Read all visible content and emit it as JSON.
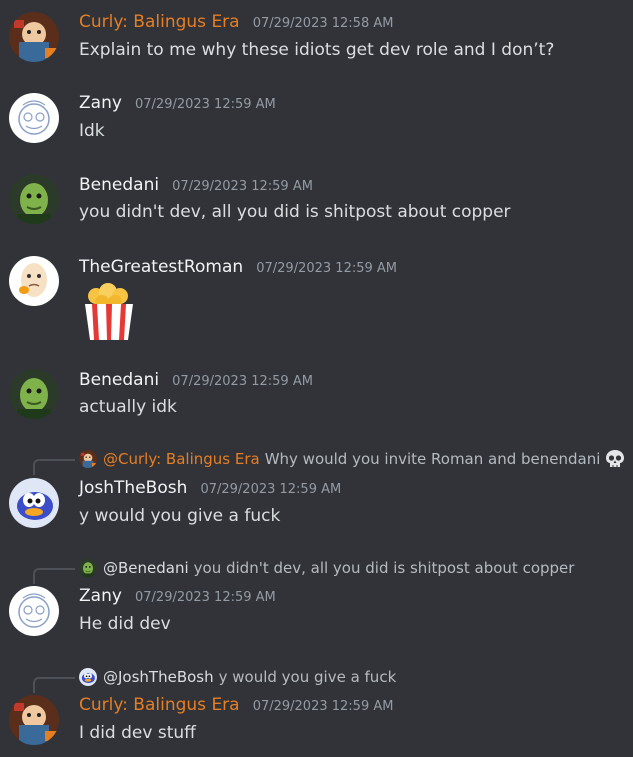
{
  "colors": {
    "background": "#313338",
    "text": "#dbdee1",
    "timestamp": "#949ba4",
    "author_default": "#f2f3f5",
    "author_orange": "#e67e22"
  },
  "messages": [
    {
      "author": "Curly: Balingus Era",
      "author_color": "#e67e22",
      "timestamp": "07/29/2023 12:58 AM",
      "content": "Explain to me why these idiots get dev role and I don’t?",
      "avatar_icon": "cartoon-character-avatar"
    },
    {
      "author": "Zany",
      "author_color": "#f2f3f5",
      "timestamp": "07/29/2023 12:59 AM",
      "content": "Idk",
      "avatar_icon": "sketch-face-avatar"
    },
    {
      "author": "Benedani",
      "author_color": "#f2f3f5",
      "timestamp": "07/29/2023 12:59 AM",
      "content": "you didn't dev, all you did is shitpost about copper",
      "avatar_icon": "green-face-avatar"
    },
    {
      "author": "TheGreatestRoman",
      "author_color": "#f2f3f5",
      "timestamp": "07/29/2023 12:59 AM",
      "content": "",
      "emoji": "popcorn",
      "avatar_icon": "thinking-egg-avatar"
    },
    {
      "author": "Benedani",
      "author_color": "#f2f3f5",
      "timestamp": "07/29/2023 12:59 AM",
      "content": "actually idk",
      "avatar_icon": "green-face-avatar"
    },
    {
      "author": "JoshTheBosh",
      "author_color": "#f2f3f5",
      "timestamp": "07/29/2023 12:59 AM",
      "content": "y would you give a fuck",
      "avatar_icon": "cartoon-bird-avatar",
      "reply": {
        "author": "@Curly: Balingus Era",
        "author_color": "#e67e22",
        "text": "Why would you invite Roman and benendani",
        "emoji": "skull"
      }
    },
    {
      "author": "Zany",
      "author_color": "#f2f3f5",
      "timestamp": "07/29/2023 12:59 AM",
      "content": "He did dev",
      "avatar_icon": "sketch-face-avatar",
      "reply": {
        "author": "@Benedani",
        "author_color": "#dbdee1",
        "text": "you didn't dev, all you did is shitpost about copper"
      }
    },
    {
      "author": "Curly: Balingus Era",
      "author_color": "#e67e22",
      "timestamp": "07/29/2023 12:59 AM",
      "content": "I did dev stuff",
      "avatar_icon": "cartoon-character-avatar",
      "reply": {
        "author": "@JoshTheBosh",
        "author_color": "#dbdee1",
        "text": "y would you give a fuck"
      }
    }
  ]
}
